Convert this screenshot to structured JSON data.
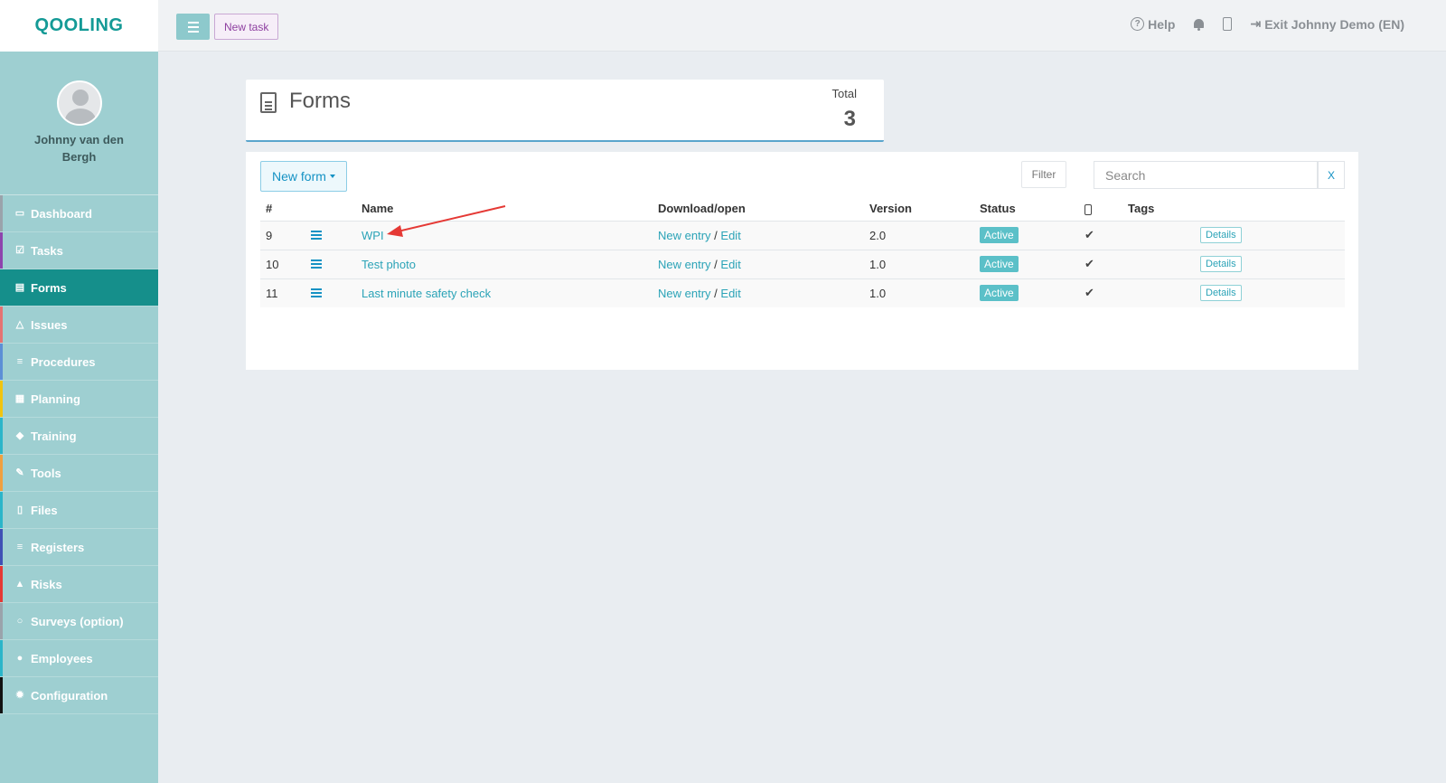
{
  "app": {
    "logo_text": "QOOLING"
  },
  "topbar": {
    "new_task_label": "New task",
    "help_label": "Help",
    "exit_label": "Exit Johnny Demo (EN)"
  },
  "profile": {
    "name": "Johnny van den Bergh"
  },
  "sidebar": {
    "items": [
      {
        "label": "Dashboard",
        "icon": "monitor-icon",
        "color": "#9aa3ab"
      },
      {
        "label": "Tasks",
        "icon": "checkbox-icon",
        "color": "#8e44ad"
      },
      {
        "label": "Forms",
        "icon": "document-icon",
        "color": "#158f8b",
        "active": true
      },
      {
        "label": "Issues",
        "icon": "bell-icon",
        "color": "#e57373"
      },
      {
        "label": "Procedures",
        "icon": "list-icon",
        "color": "#5c8fd6"
      },
      {
        "label": "Planning",
        "icon": "calendar-icon",
        "color": "#f1c40f"
      },
      {
        "label": "Training",
        "icon": "graduation-cap-icon",
        "color": "#2bb5c9"
      },
      {
        "label": "Tools",
        "icon": "wrench-icon",
        "color": "#f0a040"
      },
      {
        "label": "Files",
        "icon": "pdf-file-icon",
        "color": "#2bb5c9"
      },
      {
        "label": "Registers",
        "icon": "list-icon",
        "color": "#3f51b5"
      },
      {
        "label": "Risks",
        "icon": "warning-icon",
        "color": "#e53935"
      },
      {
        "label": "Surveys (option)",
        "icon": "comment-icon",
        "color": "#9aa3ab"
      },
      {
        "label": "Employees",
        "icon": "users-icon",
        "color": "#2bb5c9"
      },
      {
        "label": "Configuration",
        "icon": "gear-icon",
        "color": "#111111"
      }
    ]
  },
  "header": {
    "title": "Forms",
    "total_label": "Total",
    "total_value": "3"
  },
  "toolbar": {
    "new_form_label": "New form",
    "filter_label": "Filter",
    "search_placeholder": "Search",
    "clear_label": "X"
  },
  "table": {
    "columns": {
      "num": "#",
      "name": "Name",
      "download": "Download/open",
      "version": "Version",
      "status": "Status",
      "tags": "Tags"
    },
    "rows": [
      {
        "num": "9",
        "name": "WPI",
        "new_entry": "New entry",
        "sep": "/",
        "edit": "Edit",
        "version": "2.0",
        "status": "Active",
        "check": "✔",
        "details": "Details"
      },
      {
        "num": "10",
        "name": "Test photo",
        "new_entry": "New entry",
        "sep": "/",
        "edit": "Edit",
        "version": "1.0",
        "status": "Active",
        "check": "✔",
        "details": "Details"
      },
      {
        "num": "11",
        "name": "Last minute safety check",
        "new_entry": "New entry",
        "sep": "/",
        "edit": "Edit",
        "version": "1.0",
        "status": "Active",
        "check": "✔",
        "details": "Details"
      }
    ]
  },
  "colors": {
    "accent": "#158f8b",
    "sidebar_bg": "#9ecfd1",
    "link": "#2ba3b7",
    "badge": "#5bc0c8",
    "annotation_arrow": "#e53935"
  }
}
